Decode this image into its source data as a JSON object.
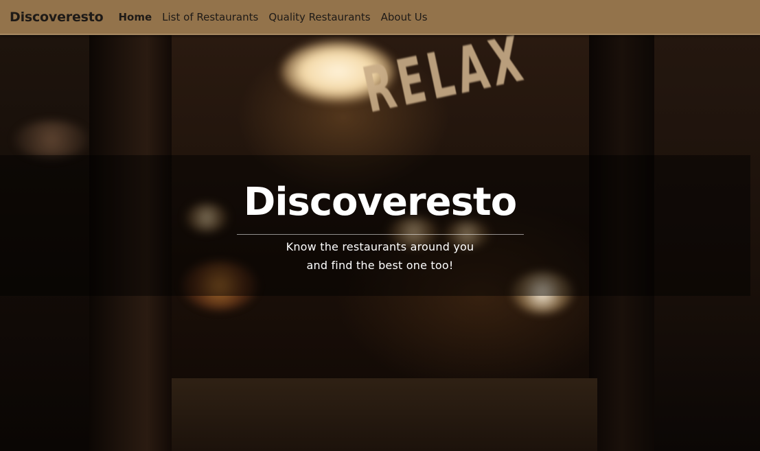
{
  "navbar": {
    "brand": "Discoveresto",
    "links": [
      {
        "label": "Home",
        "active": true
      },
      {
        "label": "List of Restaurants",
        "active": false
      },
      {
        "label": "Quality Restaurants",
        "active": false
      },
      {
        "label": "About Us",
        "active": false
      }
    ]
  },
  "hero": {
    "sign_text": "RELAX",
    "title": "Discoveresto",
    "subtitle_line1": "Know the restaurants around you",
    "subtitle_line2": "and find the best one too!"
  },
  "colors": {
    "navbar_bg": "#93734b",
    "nav_text": "#1e1a17",
    "hero_text": "#ffffff"
  }
}
